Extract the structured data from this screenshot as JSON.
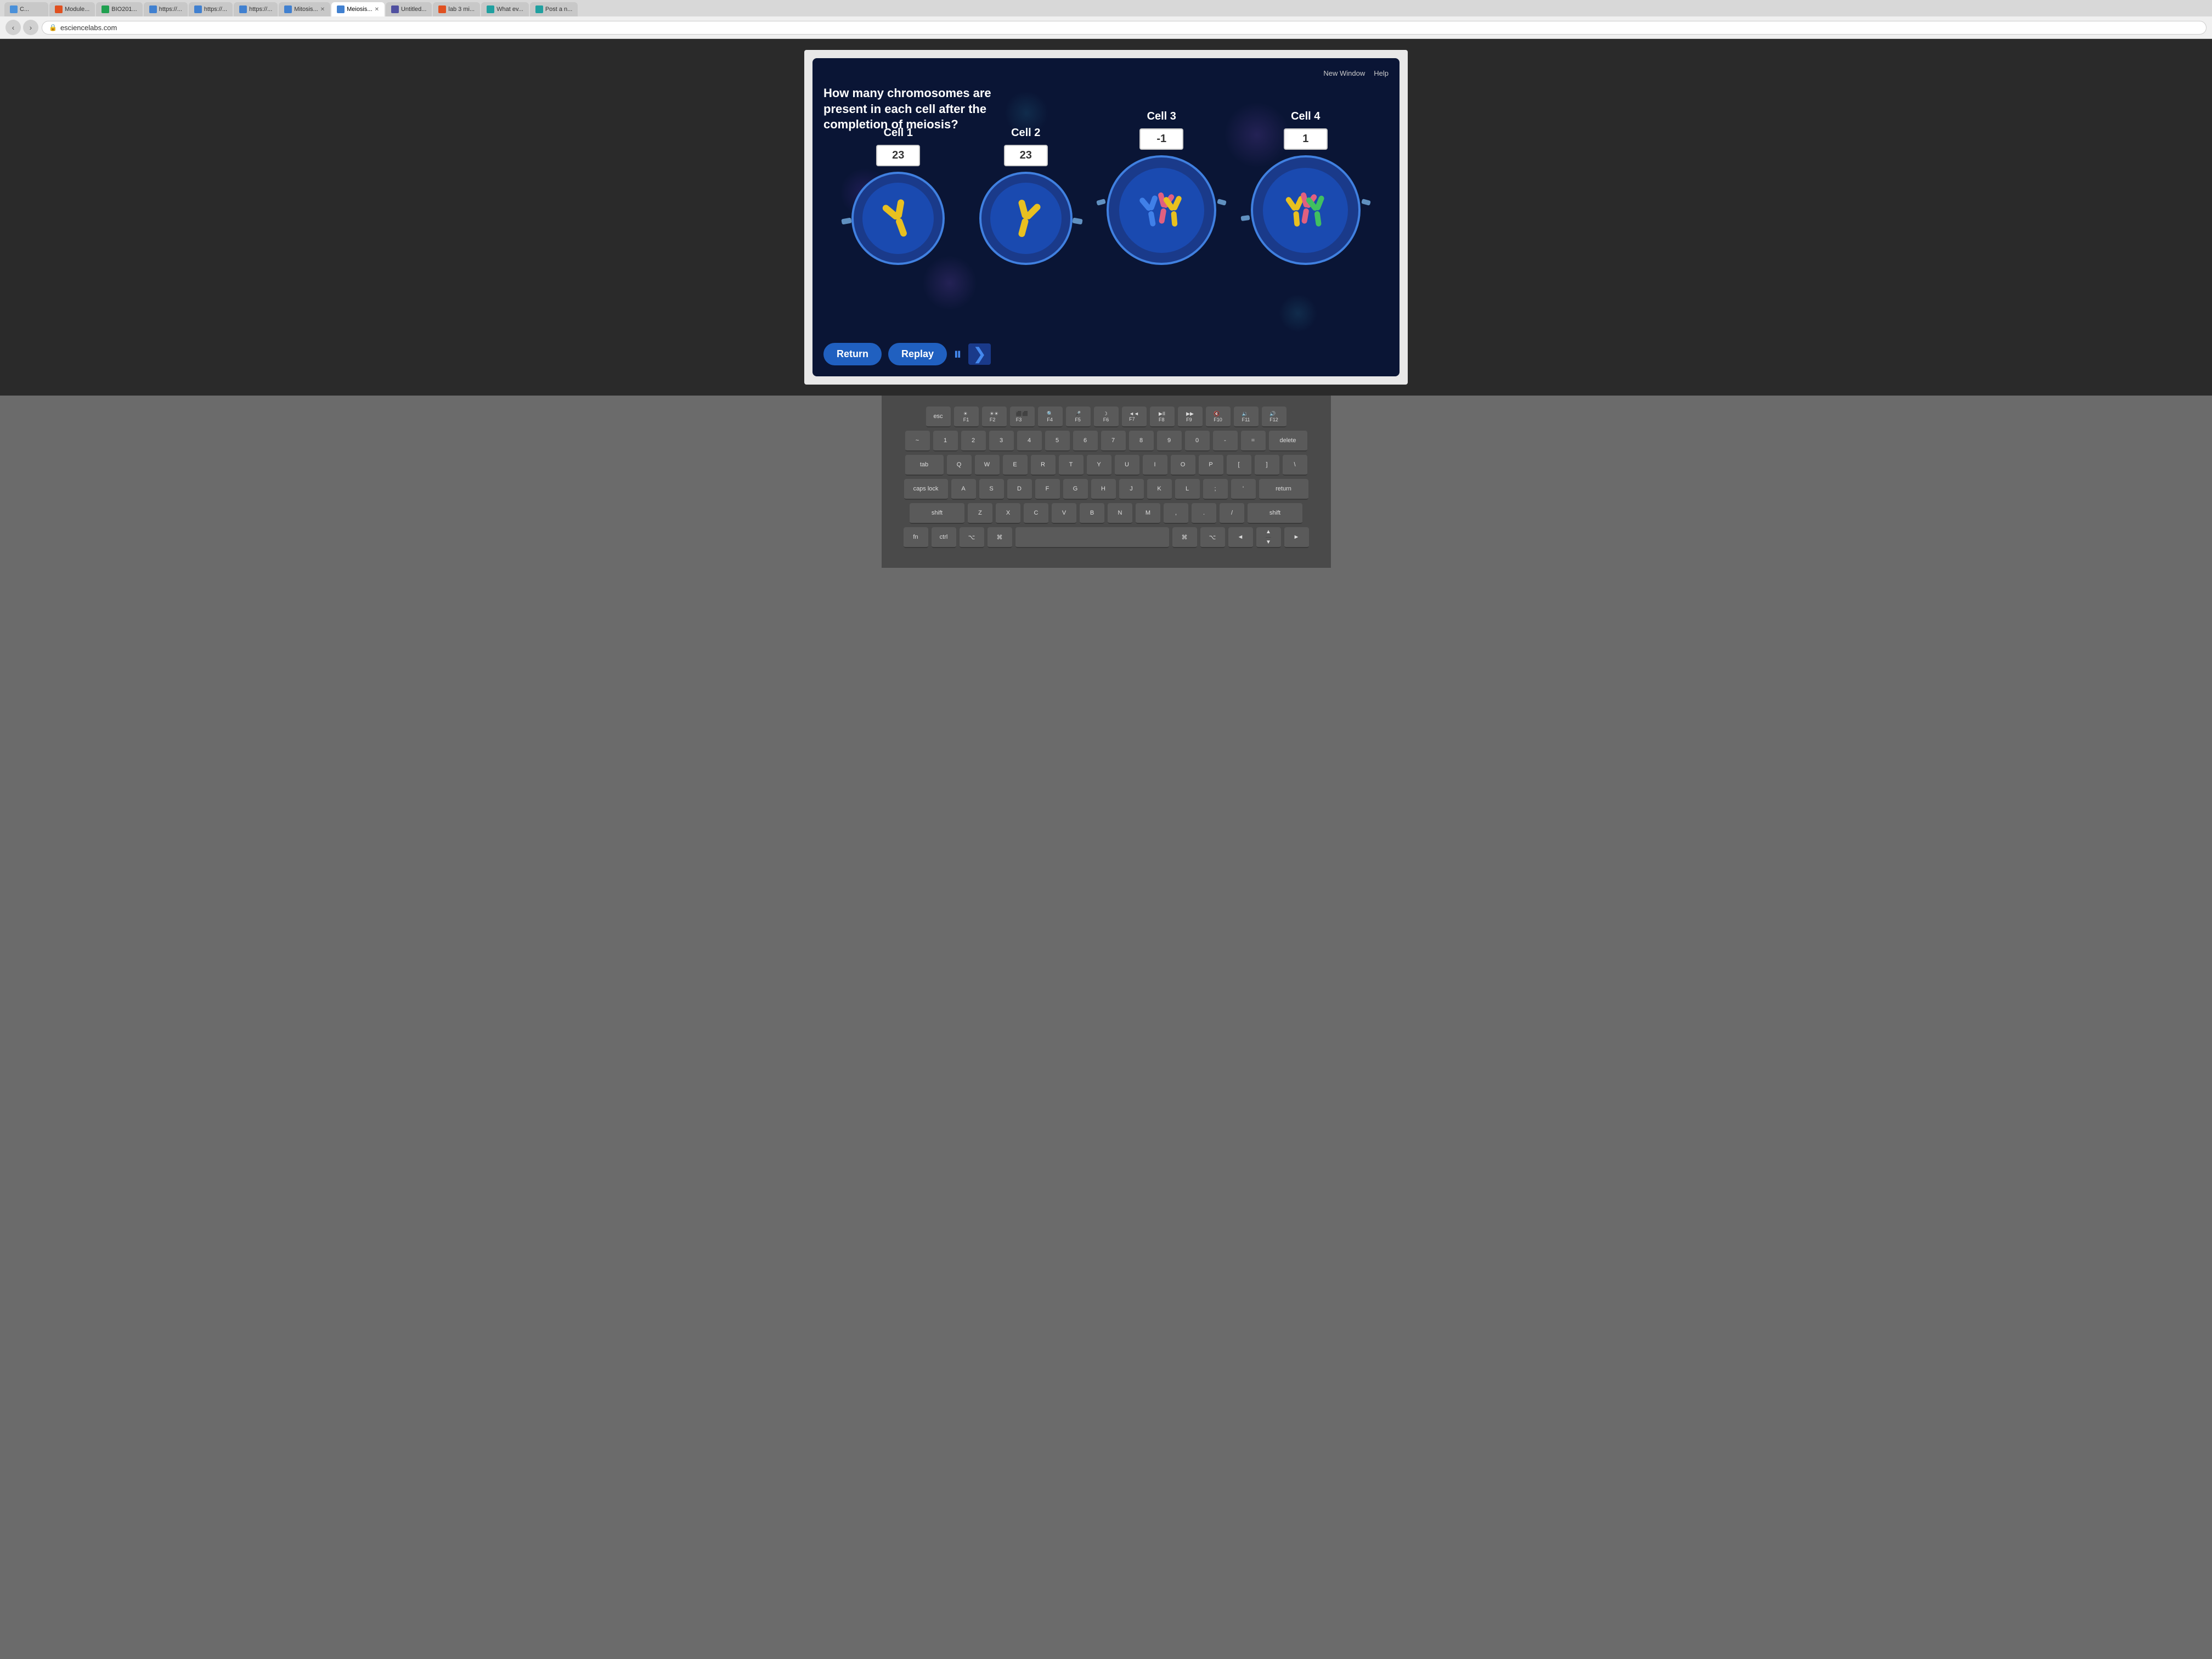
{
  "browser": {
    "url": "esciencelabs.com",
    "tabs": [
      {
        "id": "tab1",
        "label": "C...",
        "favicon": "c",
        "active": false
      },
      {
        "id": "tab2",
        "label": "Module...",
        "favicon": "m",
        "active": false
      },
      {
        "id": "tab3",
        "label": "BIO201...",
        "favicon": "b",
        "active": false
      },
      {
        "id": "tab4",
        "label": "https://...",
        "favicon": "h",
        "active": false
      },
      {
        "id": "tab5",
        "label": "https://...",
        "favicon": "h",
        "active": false
      },
      {
        "id": "tab6",
        "label": "https://...",
        "favicon": "h",
        "active": false
      },
      {
        "id": "tab7",
        "label": "Mitosis...",
        "favicon": "m",
        "active": false
      },
      {
        "id": "tab8",
        "label": "Meiosis...",
        "favicon": "m",
        "active": true
      },
      {
        "id": "tab9",
        "label": "Untitled...",
        "favicon": "u",
        "active": false
      },
      {
        "id": "tab10",
        "label": "lab 3 mi...",
        "favicon": "l",
        "active": false
      },
      {
        "id": "tab11",
        "label": "What ev...",
        "favicon": "w",
        "active": false
      },
      {
        "id": "tab12",
        "label": "Post a n...",
        "favicon": "p",
        "active": false
      }
    ]
  },
  "topLinks": {
    "newWindow": "New Window",
    "help": "Help"
  },
  "question": {
    "text": "How many chromosomes are present in each cell after the completion of meiosis?"
  },
  "cells": [
    {
      "id": "cell1",
      "label": "Cell 1",
      "value": "23",
      "chromosomeColor": "yellow"
    },
    {
      "id": "cell2",
      "label": "Cell 2",
      "value": "23",
      "chromosomeColor": "yellow"
    },
    {
      "id": "cell3",
      "label": "Cell 3",
      "value": "-1",
      "chromosomeColor": "multi"
    },
    {
      "id": "cell4",
      "label": "Cell 4",
      "value": "1",
      "chromosomeColor": "multi"
    }
  ],
  "controls": {
    "returnLabel": "Return",
    "replayLabel": "Replay",
    "pauseIcon": "⏸",
    "nextIcon": "❯"
  }
}
